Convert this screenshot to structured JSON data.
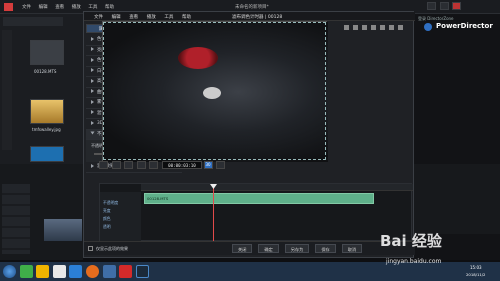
{
  "app": {
    "menu": [
      "文件",
      "编辑",
      "查看",
      "播放",
      "工具",
      "帮助"
    ],
    "project_title": "未命名的新项目*",
    "brand": "PowerDirector",
    "login": "登录 DirectorZone"
  },
  "library": {
    "items": [
      {
        "label": "00128.MTS",
        "color": "#3b3f45"
      },
      {
        "label": "tmfswalley.jpg",
        "color": "#d9a040"
      },
      {
        "label": "",
        "color": "#1d6fb0"
      }
    ]
  },
  "dialog": {
    "title": "滤布调色计时器 | 00128",
    "menu": [
      "文件",
      "编辑",
      "查看",
      "播放",
      "工具",
      "帮助"
    ],
    "tabs": [
      "调节",
      "效果",
      "设置"
    ],
    "params": [
      {
        "label": "色调调整",
        "open": false
      },
      {
        "label": "亮度",
        "open": false
      },
      {
        "label": "色调",
        "open": false
      },
      {
        "label": "白平衡",
        "open": false
      },
      {
        "label": "高光",
        "open": false
      },
      {
        "label": "曲线",
        "open": false
      },
      {
        "label": "雾化",
        "open": false
      },
      {
        "label": "混色处理",
        "open": false
      },
      {
        "label": "3D 处理",
        "open": false
      },
      {
        "label": "不透明度",
        "open": true
      }
    ],
    "opacity": {
      "label": "不透明（关键帧）",
      "value": "50"
    },
    "extra_row": "混叠效果",
    "timecode": "00:00:03:10",
    "fps_badge": "30",
    "timeline": {
      "tracks": [
        "不透明度",
        "亮度",
        "颜色",
        "透明"
      ],
      "clip": "00128.MTS"
    },
    "checkbox_label": "仅显示此项的效果",
    "bottom_buttons": [
      "关闭",
      "确定",
      "另存为",
      "保存",
      "取消"
    ]
  },
  "timeline": {
    "button": "分割"
  },
  "taskbar": {
    "clock": "15:03",
    "date": "2018/11/2"
  },
  "watermark": {
    "brand": "Bai 经验",
    "url": "jingyan.baidu.com"
  },
  "colors": {
    "accent": "#314a6a",
    "clip": "#5fb08a",
    "playhead": "#e24a4a"
  }
}
